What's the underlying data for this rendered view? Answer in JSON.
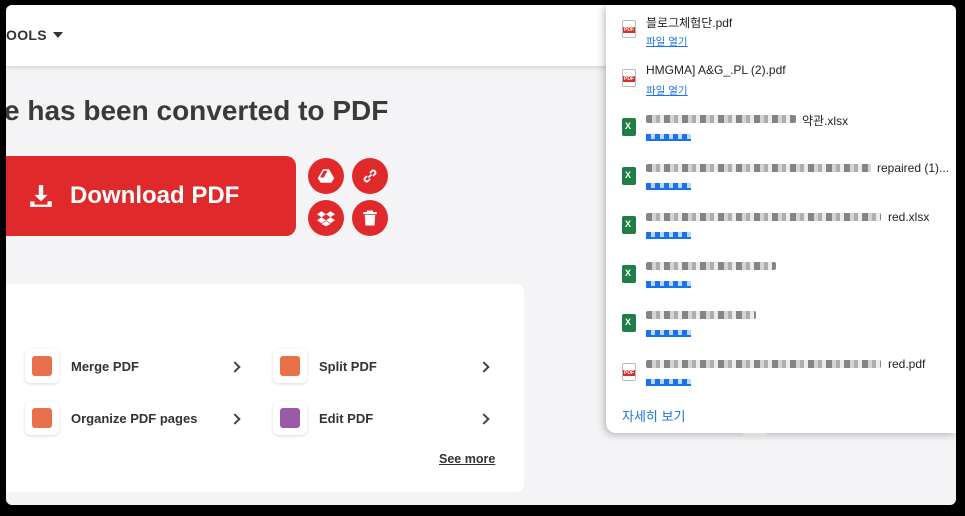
{
  "nav": {
    "tools_label": "OOLS"
  },
  "hero": {
    "headline": "e has been converted to PDF",
    "download_label": "Download PDF"
  },
  "actions": {
    "drive": "google-drive-icon",
    "link": "link-icon",
    "dropbox": "dropbox-icon",
    "delete": "trash-icon"
  },
  "tools": [
    {
      "label": "Merge PDF",
      "color": "#e8704a"
    },
    {
      "label": "Split PDF",
      "color": "#e8704a"
    },
    {
      "label": "Organize PDF pages",
      "color": "#e8704a"
    },
    {
      "label": "Edit PDF",
      "color": "#9b5aa8"
    }
  ],
  "see_more": "See more",
  "downloads": {
    "items": [
      {
        "name": "블로그체험단.pdf",
        "type": "pdf",
        "open": "파일 열기"
      },
      {
        "name": "HMGMA] A&G_.PL (2).pdf",
        "type": "pdf",
        "open": "파일 열기"
      },
      {
        "name": "약관.xlsx",
        "type": "xls",
        "open": ""
      },
      {
        "name": "repaired (1)...",
        "type": "xls",
        "open": ""
      },
      {
        "name": "red.xlsx",
        "type": "xls",
        "open": ""
      },
      {
        "name": "",
        "type": "xls",
        "open": ""
      },
      {
        "name": "",
        "type": "xls",
        "open": ""
      },
      {
        "name": "red.pdf",
        "type": "pdf",
        "open": ""
      }
    ],
    "see_all": "자세히 보기"
  }
}
